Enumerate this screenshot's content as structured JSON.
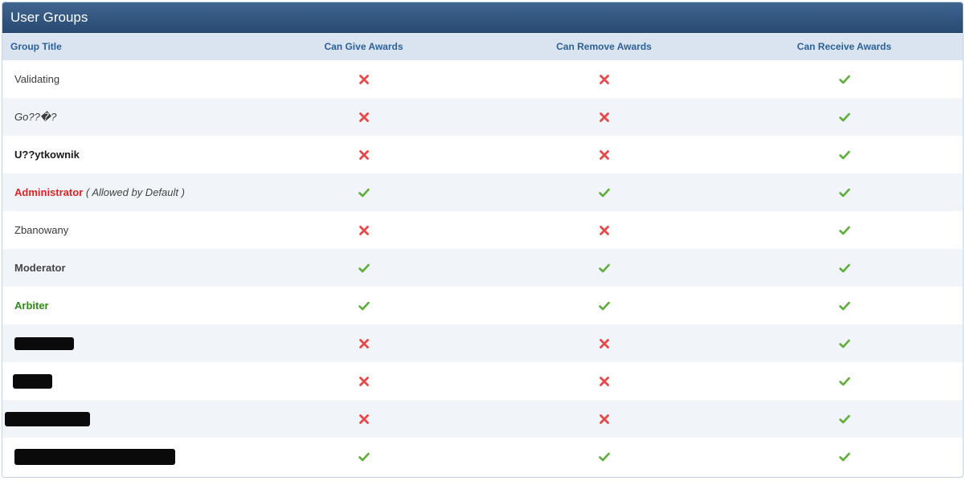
{
  "panel": {
    "title": "User Groups"
  },
  "columns": {
    "group_title": "Group Title",
    "can_give": "Can Give Awards",
    "can_remove": "Can Remove Awards",
    "can_receive": "Can Receive Awards"
  },
  "rows": [
    {
      "name": "Validating",
      "note": "",
      "give": false,
      "remove": false,
      "receive": true
    },
    {
      "name": "Go??�?",
      "note": "",
      "give": false,
      "remove": false,
      "receive": true
    },
    {
      "name": "U??ytkownik",
      "note": "",
      "give": false,
      "remove": false,
      "receive": true
    },
    {
      "name": "Administrator",
      "note": "Allowed by Default",
      "give": true,
      "remove": true,
      "receive": true
    },
    {
      "name": "Zbanowany",
      "note": "",
      "give": false,
      "remove": false,
      "receive": true
    },
    {
      "name": "Moderator",
      "note": "",
      "give": true,
      "remove": true,
      "receive": true
    },
    {
      "name": "Arbiter",
      "note": "",
      "give": true,
      "remove": true,
      "receive": true
    },
    {
      "name": "",
      "note": "",
      "give": false,
      "remove": false,
      "receive": true
    },
    {
      "name": "",
      "note": "",
      "give": false,
      "remove": false,
      "receive": true
    },
    {
      "name": "",
      "note": "",
      "give": false,
      "remove": false,
      "receive": true
    },
    {
      "name": "",
      "note": "",
      "give": true,
      "remove": true,
      "receive": true
    }
  ],
  "colors": {
    "check": "#5fae3c",
    "cross": "#e74848"
  },
  "icons": {
    "yes": "check-icon",
    "no": "cross-icon"
  }
}
